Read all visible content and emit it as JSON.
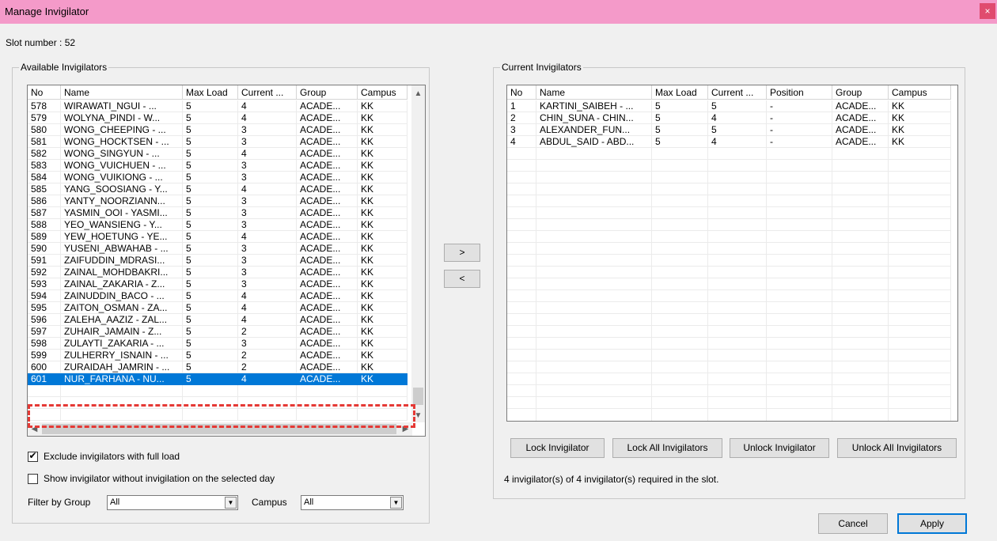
{
  "window": {
    "title": "Manage Invigilator",
    "close_glyph": "×"
  },
  "slot_text": "Slot number : 52",
  "available": {
    "legend": "Available Invigilators",
    "columns": [
      "No",
      "Name",
      "Max Load",
      "Current ...",
      "Group",
      "Campus"
    ],
    "rows": [
      [
        "578",
        "WIRAWATI_NGUI - ...",
        "5",
        "4",
        "ACADE...",
        "KK"
      ],
      [
        "579",
        "WOLYNA_PINDI - W...",
        "5",
        "4",
        "ACADE...",
        "KK"
      ],
      [
        "580",
        "WONG_CHEEPING - ...",
        "5",
        "3",
        "ACADE...",
        "KK"
      ],
      [
        "581",
        "WONG_HOCKTSEN - ...",
        "5",
        "3",
        "ACADE...",
        "KK"
      ],
      [
        "582",
        "WONG_SINGYUN - ...",
        "5",
        "4",
        "ACADE...",
        "KK"
      ],
      [
        "583",
        "WONG_VUICHUEN - ...",
        "5",
        "3",
        "ACADE...",
        "KK"
      ],
      [
        "584",
        "WONG_VUIKIONG - ...",
        "5",
        "3",
        "ACADE...",
        "KK"
      ],
      [
        "585",
        "YANG_SOOSIANG - Y...",
        "5",
        "4",
        "ACADE...",
        "KK"
      ],
      [
        "586",
        "YANTY_NOORZIANN...",
        "5",
        "3",
        "ACADE...",
        "KK"
      ],
      [
        "587",
        "YASMIN_OOI - YASMI...",
        "5",
        "3",
        "ACADE...",
        "KK"
      ],
      [
        "588",
        "YEO_WANSIENG - Y...",
        "5",
        "3",
        "ACADE...",
        "KK"
      ],
      [
        "589",
        "YEW_HOETUNG - YE...",
        "5",
        "4",
        "ACADE...",
        "KK"
      ],
      [
        "590",
        "YUSENI_ABWAHAB - ...",
        "5",
        "3",
        "ACADE...",
        "KK"
      ],
      [
        "591",
        "ZAIFUDDIN_MDRASI...",
        "5",
        "3",
        "ACADE...",
        "KK"
      ],
      [
        "592",
        "ZAINAL_MOHDBAKRI...",
        "5",
        "3",
        "ACADE...",
        "KK"
      ],
      [
        "593",
        "ZAINAL_ZAKARIA - Z...",
        "5",
        "3",
        "ACADE...",
        "KK"
      ],
      [
        "594",
        "ZAINUDDIN_BACO - ...",
        "5",
        "4",
        "ACADE...",
        "KK"
      ],
      [
        "595",
        "ZAITON_OSMAN - ZA...",
        "5",
        "4",
        "ACADE...",
        "KK"
      ],
      [
        "596",
        "ZALEHA_AAZIZ - ZAL...",
        "5",
        "4",
        "ACADE...",
        "KK"
      ],
      [
        "597",
        "ZUHAIR_JAMAIN - Z...",
        "5",
        "2",
        "ACADE...",
        "KK"
      ],
      [
        "598",
        "ZULAYTI_ZAKARIA - ...",
        "5",
        "3",
        "ACADE...",
        "KK"
      ],
      [
        "599",
        "ZULHERRY_ISNAIN - ...",
        "5",
        "2",
        "ACADE...",
        "KK"
      ],
      [
        "600",
        "ZURAIDAH_JAMRIN - ...",
        "5",
        "2",
        "ACADE...",
        "KK"
      ],
      [
        "601",
        "NUR_FARHANA - NU...",
        "5",
        "4",
        "ACADE...",
        "KK"
      ]
    ],
    "selected_row": 23,
    "exclude_full_load": {
      "label": "Exclude invigilators with full load",
      "checked": true,
      "mark": "✔"
    },
    "show_without_invigilation": {
      "label": "Show invigilator without invigilation on the selected day",
      "checked": false
    },
    "filter_group_label": "Filter by Group",
    "filter_group_value": "All",
    "campus_label": "Campus",
    "campus_value": "All"
  },
  "move_buttons": {
    "add": ">",
    "remove": "<"
  },
  "current": {
    "legend": "Current Invigilators",
    "columns": [
      "No",
      "Name",
      "Max Load",
      "Current ...",
      "Position",
      "Group",
      "Campus"
    ],
    "rows": [
      [
        "1",
        "KARTINI_SAIBEH - ...",
        "5",
        "5",
        "-",
        "ACADE...",
        "KK"
      ],
      [
        "2",
        "CHIN_SUNA - CHIN...",
        "5",
        "4",
        "-",
        "ACADE...",
        "KK"
      ],
      [
        "3",
        "ALEXANDER_FUN...",
        "5",
        "5",
        "-",
        "ACADE...",
        "KK"
      ],
      [
        "4",
        "ABDUL_SAID - ABD...",
        "5",
        "4",
        "-",
        "ACADE...",
        "KK"
      ]
    ],
    "buttons": {
      "lock": "Lock Invigilator",
      "lock_all": "Lock All Invigilators",
      "unlock": "Unlock Invigilator",
      "unlock_all": "Unlock All Invigilators"
    },
    "status": "4 invigilator(s) of 4 invigilator(s) required in the slot."
  },
  "dialog_buttons": {
    "cancel": "Cancel",
    "apply": "Apply"
  },
  "colors": {
    "titlebar": "#f49ac9",
    "selection": "#0078d7",
    "highlight_box": "#e53935"
  }
}
